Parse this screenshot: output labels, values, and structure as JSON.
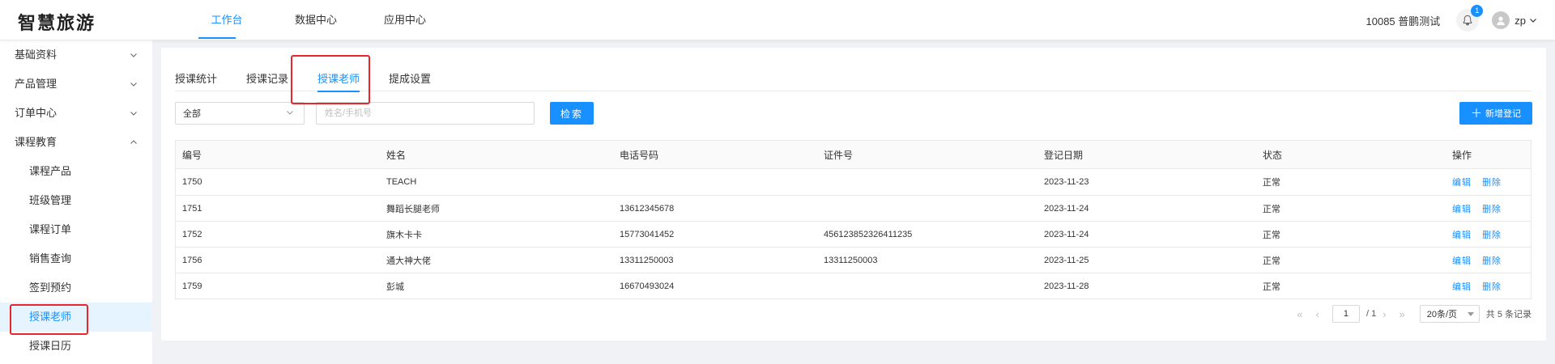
{
  "app": {
    "logo": "智慧旅游"
  },
  "topnav": [
    {
      "label": "工作台",
      "active": true
    },
    {
      "label": "数据中心",
      "active": false
    },
    {
      "label": "应用中心",
      "active": false
    }
  ],
  "header": {
    "tenant": "10085 普鹏测试",
    "notification_count": "1",
    "username": "zp"
  },
  "sidebar": {
    "groups": [
      {
        "label": "基础资料",
        "expanded": false
      },
      {
        "label": "产品管理",
        "expanded": false
      },
      {
        "label": "订单中心",
        "expanded": false
      },
      {
        "label": "课程教育",
        "expanded": true
      }
    ],
    "sub_items": [
      {
        "label": "课程产品"
      },
      {
        "label": "班级管理"
      },
      {
        "label": "课程订单"
      },
      {
        "label": "销售查询"
      },
      {
        "label": "签到预约"
      },
      {
        "label": "授课老师",
        "active": true
      },
      {
        "label": "授课日历"
      }
    ]
  },
  "tabs": [
    {
      "label": "授课统计"
    },
    {
      "label": "授课记录"
    },
    {
      "label": "授课老师",
      "active": true
    },
    {
      "label": "提成设置"
    }
  ],
  "filters": {
    "status_value": "全部",
    "search_placeholder": "姓名/手机号",
    "search_button": "检索",
    "add_button": "新增登记"
  },
  "table": {
    "columns": [
      "编号",
      "姓名",
      "电话号码",
      "证件号",
      "登记日期",
      "状态",
      "操作"
    ],
    "rows": [
      [
        "1750",
        "TEACH",
        "",
        "",
        "2023-11-23",
        "正常"
      ],
      [
        "1751",
        "舞蹈长腿老师",
        "13612345678",
        "",
        "2023-11-24",
        "正常"
      ],
      [
        "1752",
        "旗木卡卡",
        "15773041452",
        "456123852326411235",
        "2023-11-24",
        "正常"
      ],
      [
        "1756",
        "通大神大佬",
        "13311250003",
        "13311250003",
        "2023-11-25",
        "正常"
      ],
      [
        "1759",
        "彭城",
        "16670493024",
        "",
        "2023-11-28",
        "正常"
      ]
    ],
    "actions": {
      "edit": "编辑",
      "delete": "删除"
    }
  },
  "pagination": {
    "current_page": "1",
    "total_pages": "/ 1",
    "page_size": "20条/页",
    "total_text": "共 5 条记录"
  },
  "colors": {
    "primary": "#1890ff",
    "highlight": "#e8262b",
    "sidebar_active_bg": "#e6f4ff"
  }
}
